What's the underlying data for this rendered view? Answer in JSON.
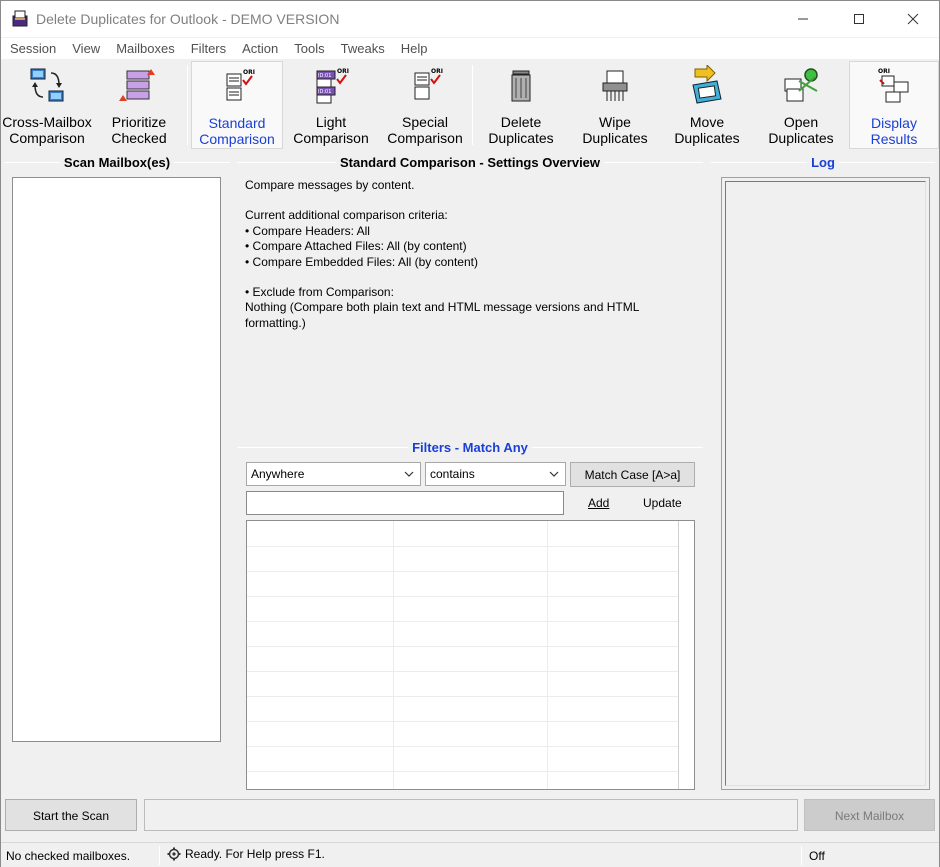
{
  "window": {
    "title": "Delete Duplicates for Outlook - DEMO VERSION",
    "controls": {
      "minimize": "—",
      "maximize": "☐",
      "close": "✕"
    }
  },
  "menu": [
    "Session",
    "View",
    "Mailboxes",
    "Filters",
    "Action",
    "Tools",
    "Tweaks",
    "Help"
  ],
  "toolbar": {
    "cross_mailbox": "Cross-Mailbox\nComparison",
    "prioritize": "Prioritize\nChecked",
    "standard": "Standard\nComparison",
    "light": "Light\nComparison",
    "special": "Special\nComparison",
    "delete": "Delete\nDuplicates",
    "wipe": "Wipe\nDuplicates",
    "move": "Move\nDuplicates",
    "open": "Open\nDuplicates",
    "display": "Display\nResults",
    "icon_tag": "ORI",
    "icon_tag_id1": "ID:01",
    "icon_tag_id2": "ID:01"
  },
  "scan_panel": {
    "title": "Scan Mailbox(es)"
  },
  "overview": {
    "title": "Standard Comparison - Settings Overview",
    "line1": "Compare messages by content.",
    "criteria_title": "Current additional comparison criteria:",
    "criteria": [
      "• Compare Headers: All",
      "• Compare Attached Files: All (by content)",
      "• Compare Embedded Files: All (by content)"
    ],
    "exclude_title": "• Exclude from Comparison:",
    "exclude_text": "Nothing (Compare both plain text and HTML message versions and HTML formatting.)"
  },
  "log": {
    "title": "Log"
  },
  "filters": {
    "title": "Filters - Match Any",
    "field_select": "Anywhere",
    "op_select": "contains",
    "match_case": "Match Case [A>a]",
    "input_value": "",
    "add": "Add",
    "update": "Update"
  },
  "bottom": {
    "start_scan": "Start the Scan",
    "next_mailbox": "Next Mailbox"
  },
  "status": {
    "mailboxes": "No checked mailboxes.",
    "ready": "Ready. For Help press F1.",
    "mode": "Off"
  }
}
